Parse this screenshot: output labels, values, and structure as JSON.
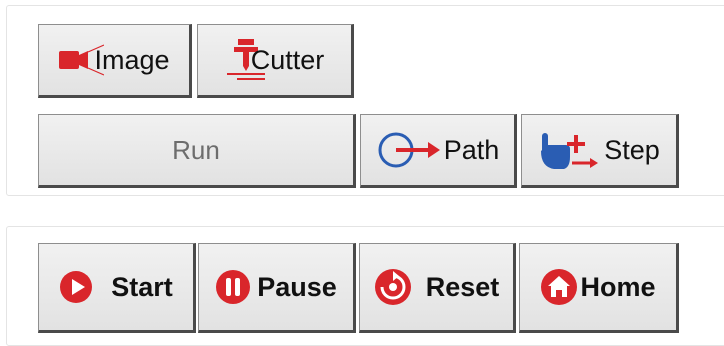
{
  "toolbar": {
    "image_label": "Image",
    "cutter_label": "Cutter",
    "run_label": "Run",
    "path_label": "Path",
    "step_label": "Step"
  },
  "controls": {
    "start_label": "Start",
    "pause_label": "Pause",
    "reset_label": "Reset",
    "home_label": "Home"
  },
  "icons": {
    "image": "camera-icon",
    "cutter": "cutter-icon",
    "path": "path-arrow-icon",
    "step": "hand-plus-icon",
    "start": "play-icon",
    "pause": "pause-icon",
    "reset": "reset-icon",
    "home": "home-icon"
  },
  "colors": {
    "accent_red": "#d9262b",
    "accent_blue": "#2a5db3",
    "button_face": "#e6e6e6",
    "disabled_text": "#6d6d6d"
  }
}
